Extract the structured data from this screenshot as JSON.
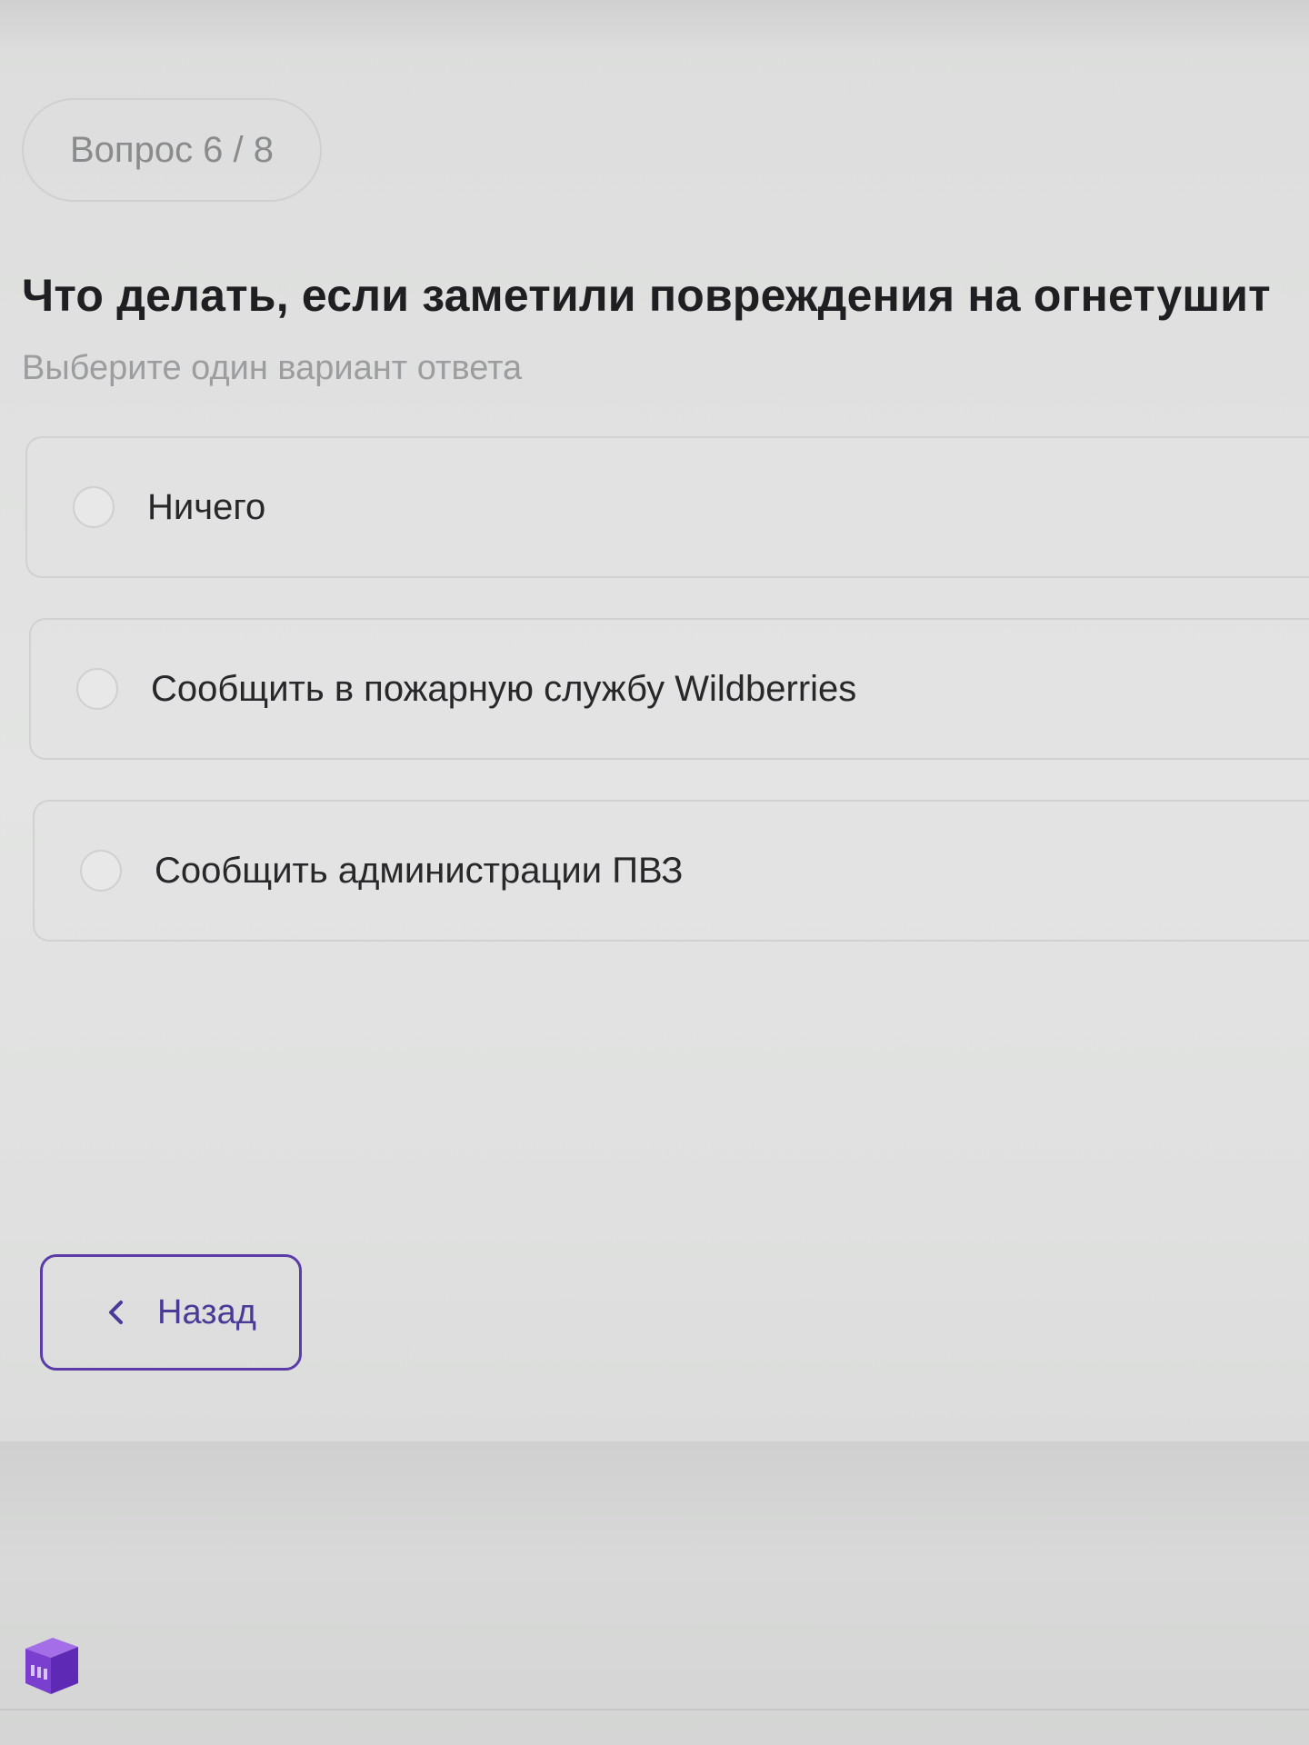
{
  "quiz": {
    "counter": "Вопрос 6 / 8",
    "question": "Что делать, если заметили повреждения на огнетушит",
    "hint": "Выберите один вариант ответа",
    "options": [
      {
        "label": "Ничего"
      },
      {
        "label": "Сообщить в пожарную службу Wildberries"
      },
      {
        "label": "Сообщить администрации ПВЗ"
      }
    ]
  },
  "navigation": {
    "back_label": "Назад",
    "back_icon": "chevron-left-icon"
  },
  "colors": {
    "accent": "#5b3ca8",
    "background": "#e0e1e0",
    "logo": "#7b3fd0"
  }
}
